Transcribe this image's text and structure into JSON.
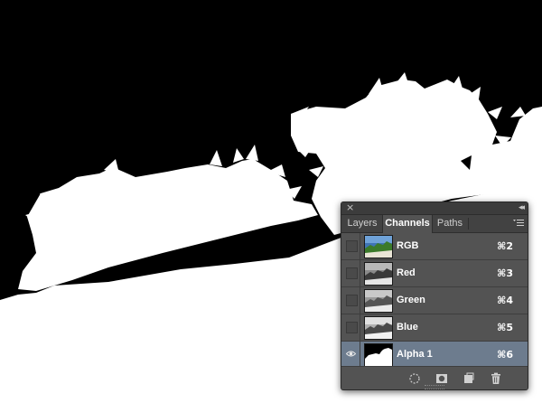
{
  "panel": {
    "tabs": [
      {
        "label": "Layers"
      },
      {
        "label": "Channels"
      },
      {
        "label": "Paths"
      }
    ],
    "active_tab": "Channels",
    "channels": [
      {
        "name": "RGB",
        "shortcut": "⌘2",
        "visible": false,
        "selected": false
      },
      {
        "name": "Red",
        "shortcut": "⌘3",
        "visible": false,
        "selected": false
      },
      {
        "name": "Green",
        "shortcut": "⌘4",
        "visible": false,
        "selected": false
      },
      {
        "name": "Blue",
        "shortcut": "⌘5",
        "visible": false,
        "selected": false
      },
      {
        "name": "Alpha 1",
        "shortcut": "⌘6",
        "visible": true,
        "selected": true
      }
    ],
    "footer_icons": [
      "load-selection-icon",
      "save-selection-icon",
      "new-channel-icon",
      "trash-icon"
    ],
    "colors": {
      "selected_row": "#6d7c8e",
      "panel_bg": "#535353"
    }
  }
}
